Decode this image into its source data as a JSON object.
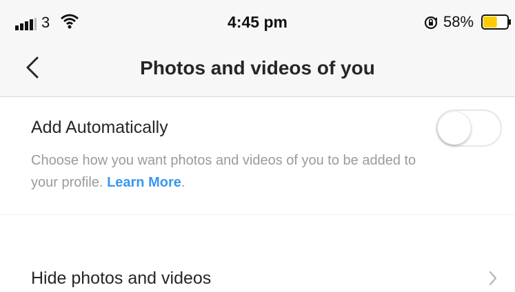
{
  "status_bar": {
    "carrier": "3",
    "time": "4:45 pm",
    "battery_percent": "58%",
    "battery_level": 0.58,
    "icons": [
      "signal-icon",
      "wifi-icon",
      "orientation-lock-icon",
      "battery-icon"
    ]
  },
  "header": {
    "back_icon": "chevron-left-icon",
    "title": "Photos and videos of you"
  },
  "add_automatically": {
    "title": "Add Automatically",
    "description": "Choose how you want photos and videos of you to be added to your profile.",
    "link": "Learn More",
    "link_suffix": ".",
    "toggle_on": false
  },
  "hide_item": {
    "label": "Hide photos and videos",
    "icon": "chevron-right-icon"
  },
  "colors": {
    "link": "#3897f0",
    "battery": "#ffcc00",
    "header_bg": "#f7f7f7"
  }
}
